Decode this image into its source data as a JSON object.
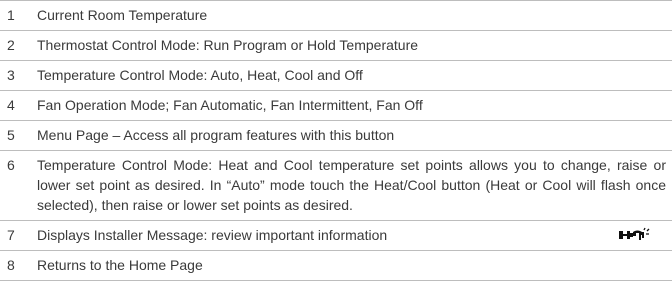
{
  "legend": {
    "rows": [
      {
        "num": "1",
        "text": "Current Room Temperature"
      },
      {
        "num": "2",
        "text": "Thermostat Control Mode: Run Program or Hold Temperature"
      },
      {
        "num": "3",
        "text": "Temperature Control Mode: Auto, Heat, Cool and Off"
      },
      {
        "num": "4",
        "text": "Fan Operation Mode; Fan Automatic, Fan Intermittent, Fan Off"
      },
      {
        "num": "5",
        "text": "Menu Page – Access all program features with this button"
      },
      {
        "num": "6",
        "text": "Temperature Control Mode: Heat and Cool temperature set points allows you to change, raise or lower set point as desired. In “Auto” mode touch the Heat/Cool button (Heat or Cool will flash once selected), then raise or lower set points as desired."
      },
      {
        "num": "7",
        "text": "Displays Installer Message: review important information",
        "icon": "installer-message-icon"
      },
      {
        "num": "8",
        "text": "Returns to the Home Page"
      }
    ]
  },
  "colors": {
    "text": "#3a3a3a",
    "rule": "#bdbdbd",
    "icon": "#111111"
  }
}
